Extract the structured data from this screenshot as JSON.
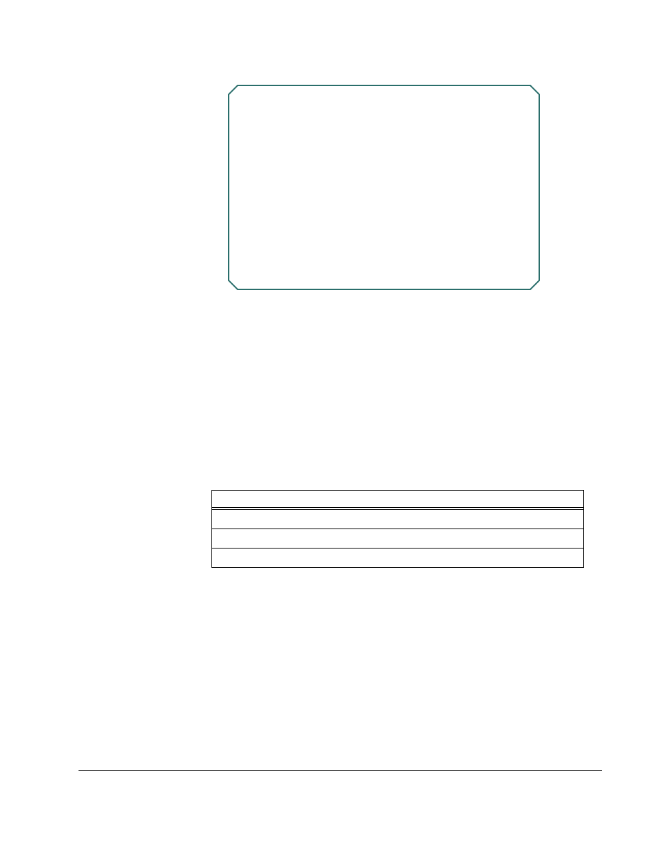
{
  "frame": {
    "stroke": "#2a6e6b",
    "corner_cut": 14
  },
  "table": {
    "header": "",
    "rows": [
      "",
      "",
      ""
    ]
  }
}
